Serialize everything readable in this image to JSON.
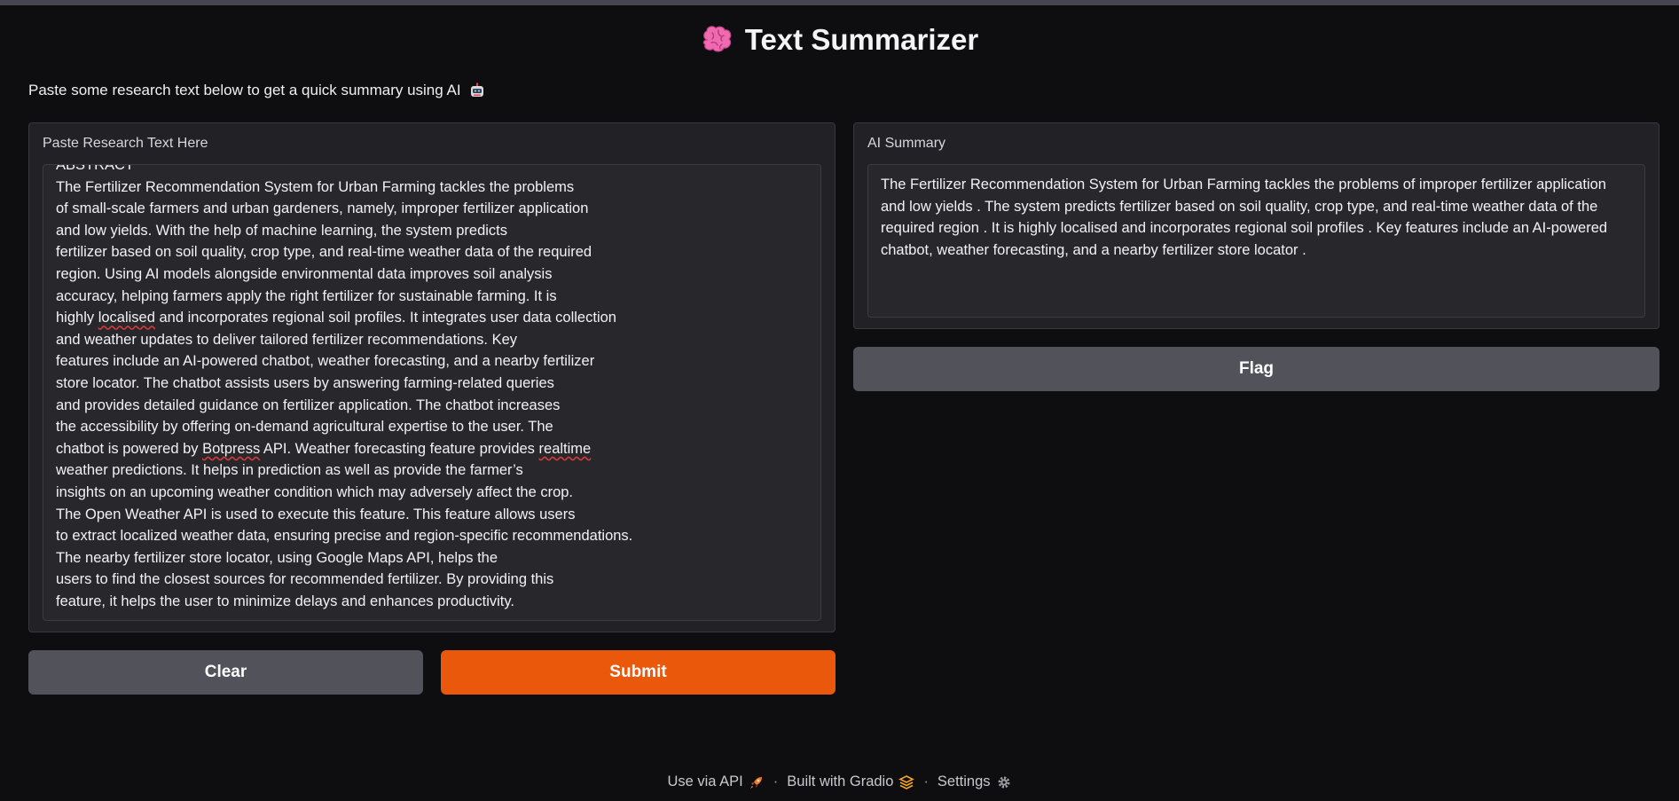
{
  "app": {
    "title": "Text Summarizer",
    "description": "Paste some research text below to get a quick summary using AI"
  },
  "input_panel": {
    "label": "Paste Research Text Here",
    "text_lines": [
      "ABSTRACT",
      "The Fertilizer Recommendation System for Urban Farming tackles the problems",
      "of small-scale farmers and urban gardeners, namely, improper fertilizer application",
      "and low yields. With the help of machine learning, the system predicts",
      "fertilizer based on soil quality, crop type, and real-time weather data of the required",
      "region. Using AI models alongside environmental data improves soil analysis",
      "accuracy, helping farmers apply the right fertilizer for sustainable farming. It is",
      "highly localised and incorporates regional soil profiles. It integrates user data collection",
      "and weather updates to deliver tailored fertilizer recommendations. Key",
      "features include an AI-powered chatbot, weather forecasting, and a nearby fertilizer",
      "store locator. The chatbot assists users by answering farming-related queries",
      "and provides detailed guidance on fertilizer application. The chatbot increases",
      "the accessibility by offering on-demand agricultural expertise to the user. The",
      "chatbot is powered by Botpress API. Weather forecasting feature provides realtime",
      "weather predictions. It helps in prediction as well as provide the farmer’s",
      "insights on an upcoming weather condition which may adversely affect the crop.",
      "The Open Weather API is used to execute this feature. This feature allows users",
      "to extract localized weather data, ensuring precise and region-specific recommendations.",
      "The nearby fertilizer store locator, using Google Maps API, helps the",
      "users to find the closest sources for recommended fertilizer. By providing this",
      "feature, it helps the user to minimize delays and enhances productivity."
    ]
  },
  "output_panel": {
    "label": "AI Summary",
    "text": " The Fertilizer Recommendation System for Urban Farming tackles the problems of improper fertilizer application and low yields . The system predicts fertilizer based on soil quality, crop type, and real-time weather data of the required region . It is highly localised and incorporates regional soil profiles . Key features include an AI-powered chatbot, weather forecasting, and a nearby fertilizer store locator ."
  },
  "buttons": {
    "clear": "Clear",
    "submit": "Submit",
    "flag": "Flag"
  },
  "footer": {
    "api": "Use via API",
    "built": "Built with Gradio",
    "settings": "Settings",
    "separator": "·"
  },
  "icons": {
    "title": "brain-icon",
    "description": "robot-icon",
    "api": "rocket-icon",
    "built": "gradio-logo-icon",
    "settings": "gear-icon"
  },
  "colors": {
    "accent": "#ea580c",
    "secondary_button": "#52525b",
    "background": "#0e0e11",
    "panel": "#222226"
  }
}
